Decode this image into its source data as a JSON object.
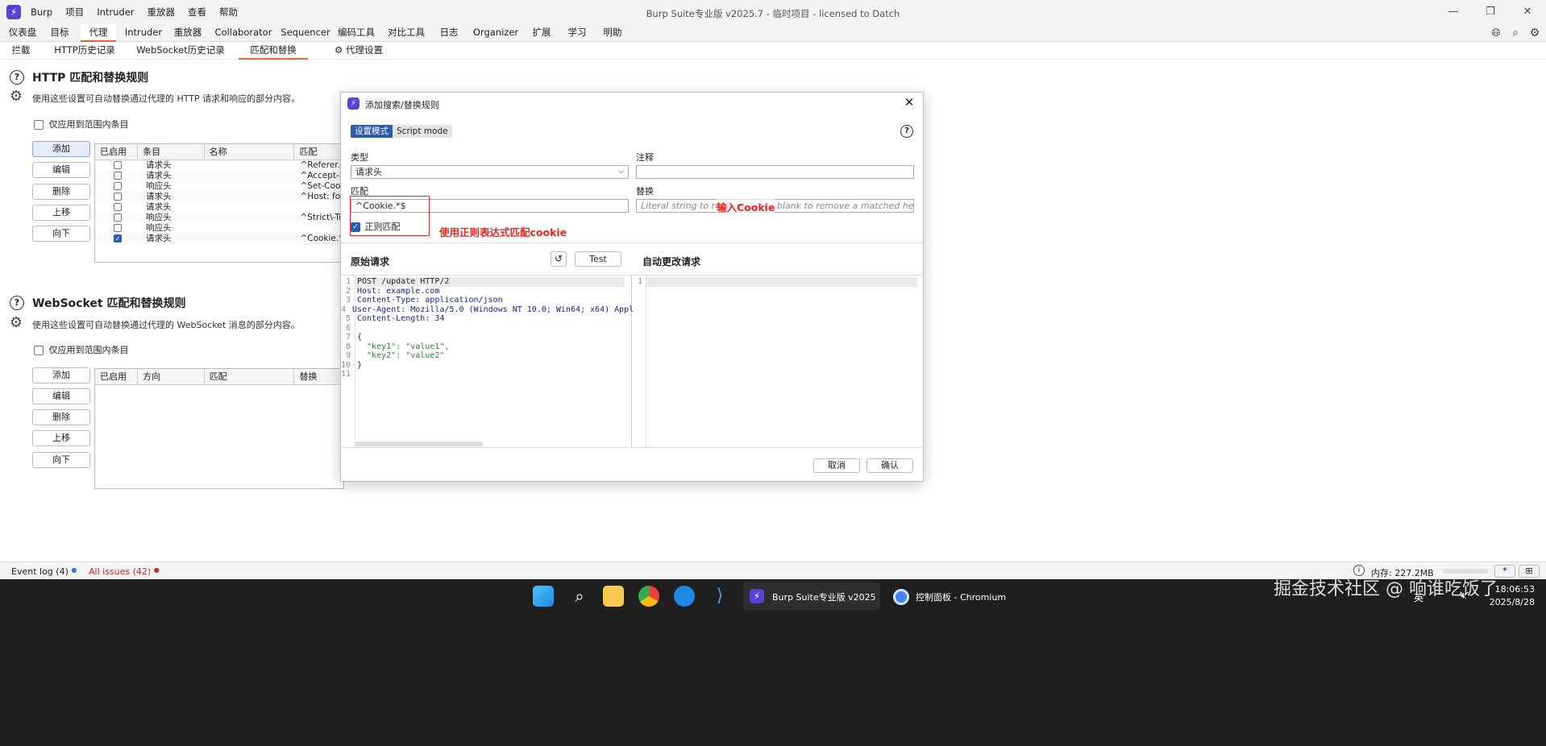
{
  "app": {
    "menu": [
      "Burp",
      "项目",
      "Intruder",
      "重放器",
      "查看",
      "帮助"
    ],
    "window_title": "Burp Suite专业版  v2025.7 - 临时项目 - licensed to Datch"
  },
  "main_tabs": [
    "仪表盘",
    "目标",
    "代理",
    "Intruder",
    "重放器",
    "Collaborator",
    "Sequencer",
    "编码工具",
    "对比工具",
    "日志",
    "Organizer",
    "扩展",
    "学习",
    "明助"
  ],
  "sub_tabs": [
    "拦截",
    "HTTP历史记录",
    "WebSocket历史记录",
    "匹配和替换",
    "代理设置"
  ],
  "http_section": {
    "title": "HTTP 匹配和替换规则",
    "description": "使用这些设置可自动替换通过代理的 HTTP 请求和响应的部分内容。",
    "scope_label": "仅应用到范围内条目",
    "buttons": [
      "添加",
      "编辑",
      "删除",
      "上移",
      "向下"
    ],
    "columns": [
      "已启用",
      "条目",
      "名称",
      "匹配"
    ],
    "rows": [
      {
        "enabled": false,
        "item": "请求头",
        "name": "",
        "match": "^Referer.*$"
      },
      {
        "enabled": false,
        "item": "请求头",
        "name": "",
        "match": "^Accept-En"
      },
      {
        "enabled": false,
        "item": "响应头",
        "name": "",
        "match": "^Set-Cookie"
      },
      {
        "enabled": false,
        "item": "请求头",
        "name": "",
        "match": "^Host: foo.e"
      },
      {
        "enabled": false,
        "item": "请求头",
        "name": "",
        "match": ""
      },
      {
        "enabled": false,
        "item": "响应头",
        "name": "",
        "match": "^Strict\\-Tran"
      },
      {
        "enabled": false,
        "item": "响应头",
        "name": "",
        "match": ""
      },
      {
        "enabled": true,
        "item": "请求头",
        "name": "",
        "match": "^Cookie.*$"
      }
    ]
  },
  "ws_section": {
    "title": "WebSocket 匹配和替换规则",
    "description": "使用这些设置可自动替换通过代理的 WebSocket 消息的部分内容。",
    "scope_label": "仅应用到范围内条目",
    "buttons": [
      "添加",
      "编辑",
      "删除",
      "上移",
      "向下"
    ],
    "columns": [
      "已启用",
      "方向",
      "匹配",
      "替换"
    ]
  },
  "dialog": {
    "title": "添加搜索/替换规则",
    "mode_tabs": [
      "设置模式",
      "Script mode"
    ],
    "type_label": "类型",
    "type_value": "请求头",
    "comment_label": "注释",
    "comment_value": "",
    "match_label": "匹配",
    "match_value": "^Cookie.*$",
    "replace_label": "替换",
    "replace_placeholder": "Literal string to replace, leave blank to remove a matched header",
    "regex_label": "正则匹配",
    "regex_checked": true,
    "annotation_replace": "输入Cookie",
    "annotation_regex": "使用正则表达式匹配cookie",
    "original_title": "原始请求",
    "test_label": "Test",
    "auto_title": "自动更改请求",
    "original_lines": [
      "POST /update HTTP/2",
      "Host: example.com",
      "Content-Type: application/json",
      "User-Agent: Mozilla/5.0 (Windows NT 10.0; Win64; x64) Appl",
      "Content-Length: 34",
      "",
      "{",
      "  \"key1\": \"value1\",",
      "  \"key2\": \"value2\"",
      "}",
      ""
    ],
    "cancel_label": "取消",
    "ok_label": "确认"
  },
  "status": {
    "event_log": "Event log (4)",
    "all_issues": "All issues (42)",
    "memory": "内存: 227.2MB"
  },
  "taskbar": {
    "burp_label": "Burp Suite专业版  v2025",
    "chromium_label": "控制面板 - Chromium",
    "ime": "英",
    "time": "18:06:53",
    "date": "2025/8/28",
    "watermark": "掘金技术社区 @ 响谁吃饭了"
  },
  "colors": {
    "accent_tab": "#e8622b",
    "brand": "#5b3fd6",
    "annotation": "#ee2222"
  }
}
